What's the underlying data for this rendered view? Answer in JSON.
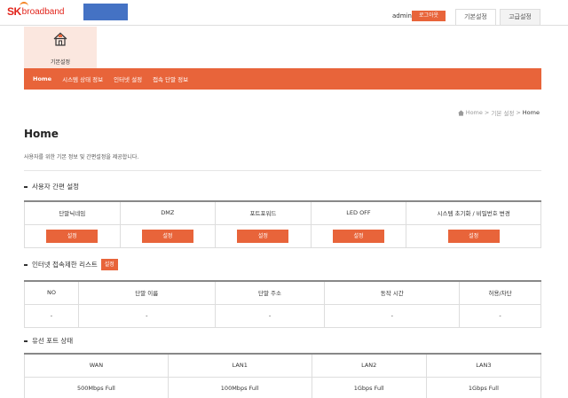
{
  "header": {
    "logo_sk": "SK",
    "logo_broadband": "broadband",
    "user": "admin",
    "logout_label": "로그아웃",
    "tabs": [
      {
        "label": "기본설정"
      },
      {
        "label": "고급설정"
      }
    ]
  },
  "home_tile": {
    "icon": "house-icon",
    "label": "기본설정"
  },
  "nav": {
    "items": [
      {
        "label": "Home"
      },
      {
        "label": "시스템 상태 정보"
      },
      {
        "label": "인터넷 설정"
      },
      {
        "label": "접속 단말 정보"
      }
    ]
  },
  "breadcrumb": {
    "icon": "home-icon",
    "items": [
      "Home",
      "기본 설정",
      "Home"
    ]
  },
  "page": {
    "title": "Home",
    "description": "사용자를 위한 기본 정보 및 간편설정을 제공합니다."
  },
  "quick_settings": {
    "title": "사용자 간편 설정",
    "columns": [
      "단말닉네임",
      "DMZ",
      "포트포워드",
      "LED OFF",
      "시스템 초기화 / 비밀번호 변경"
    ],
    "button_label": "설정"
  },
  "access_limit": {
    "title": "인터넷 접속제한 리스트",
    "button_label": "설정",
    "columns": [
      "NO",
      "단말 이름",
      "단말 주소",
      "동작 시간",
      "허용/차단"
    ],
    "rows": [
      [
        "-",
        "-",
        "-",
        "-",
        "-"
      ]
    ]
  },
  "wired_ports": {
    "title": "유선 포트 상태",
    "columns": [
      "WAN",
      "LAN1",
      "LAN2",
      "LAN3"
    ],
    "values": [
      "500Mbps Full",
      "100Mbps Full",
      "1Gbps Full",
      "1Gbps Full"
    ]
  },
  "colors": {
    "accent": "#e8643a",
    "brand_red": "#e2231a",
    "tile_bg": "#fbe7df"
  }
}
